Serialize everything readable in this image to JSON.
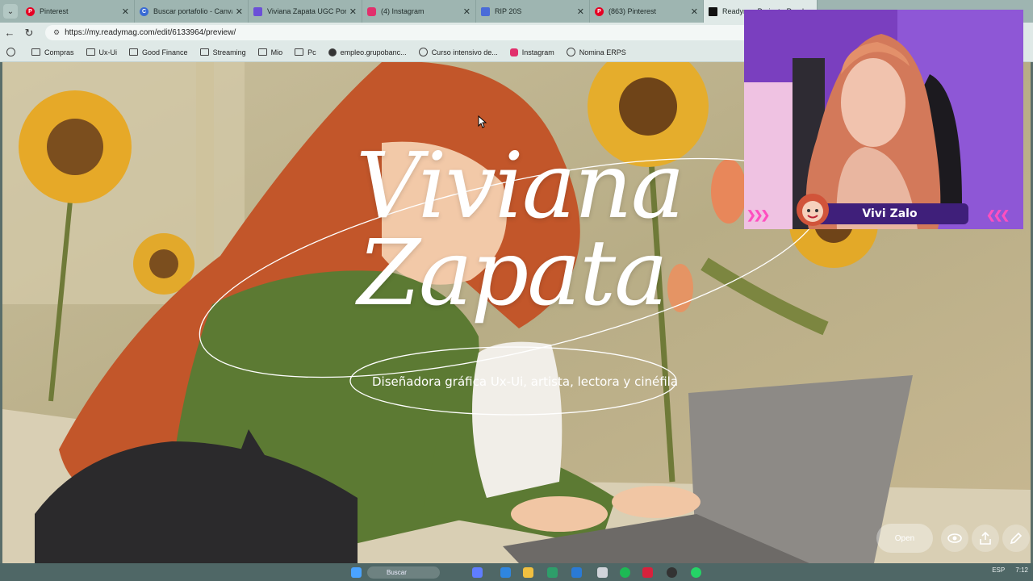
{
  "browser": {
    "tabs": [
      {
        "title": "Pinterest",
        "icon": "pinterest-icon",
        "color": "#e60023"
      },
      {
        "title": "Buscar portafolio - Canva",
        "icon": "canva-icon",
        "color": "#3a6bd4"
      },
      {
        "title": "Viviana Zapata UGC Portafol",
        "icon": "doc-icon",
        "color": "#6b4fd8"
      },
      {
        "title": "(4) Instagram",
        "icon": "instagram-icon",
        "color": "#e1306c"
      },
      {
        "title": "RIP 20S",
        "icon": "page-icon",
        "color": "#4a6bd8"
      },
      {
        "title": "(863) Pinterest",
        "icon": "pinterest-icon",
        "color": "#e60023"
      },
      {
        "title": "Readym... Project - Ready",
        "icon": "readymag-icon",
        "color": "#111111"
      }
    ],
    "url": "https://my.readymag.com/edit/6133964/preview/",
    "bookmarks": [
      "Compras",
      "Ux-Ui",
      "Good Finance",
      "Streaming",
      "Mio",
      "Pc",
      "empleo.grupobanc...",
      "Curso intensivo de...",
      "Instagram",
      "Nomina ERPS"
    ]
  },
  "hero": {
    "title_line1": "Viviana",
    "title_line2": "Zapata",
    "subtitle": "Diseñadora gráfica Ux-Ui, artista, lectora y cinéfila"
  },
  "controls": {
    "open_label": "Open"
  },
  "stream": {
    "name": "Vivi Zalo"
  },
  "taskbar": {
    "search_label": "Buscar",
    "lang": "ESP",
    "time": "7:12"
  }
}
